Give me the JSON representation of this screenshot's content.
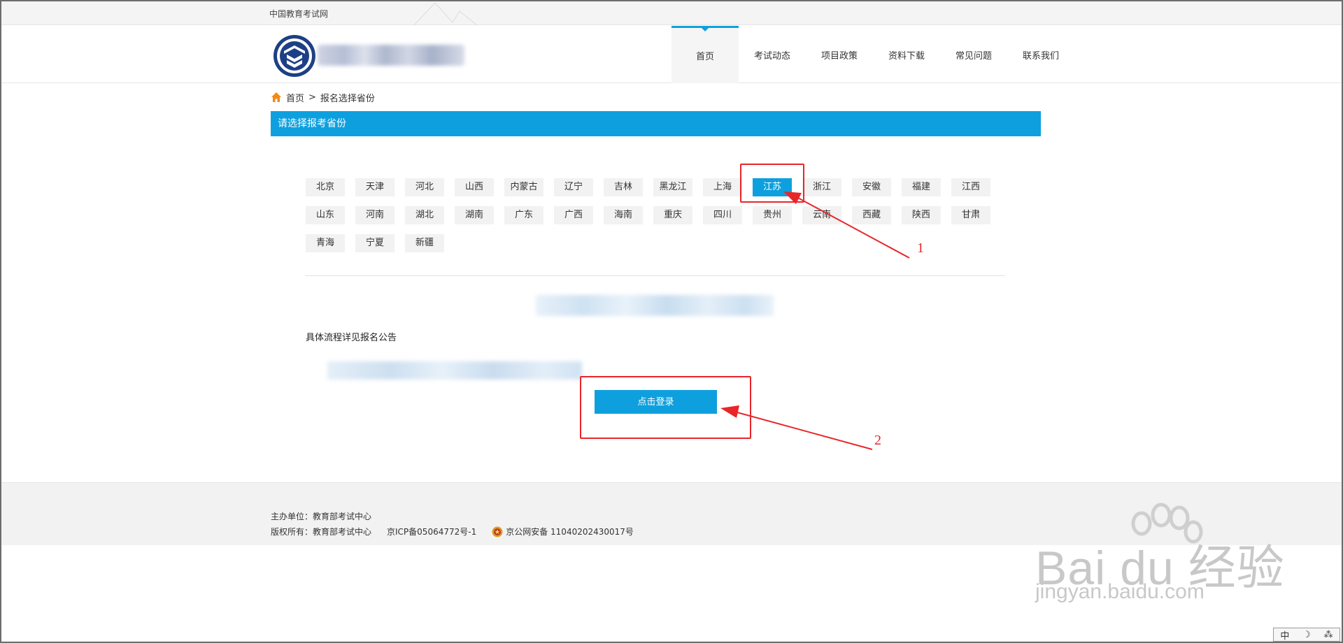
{
  "topbar": {
    "site_name": "中国教育考试网"
  },
  "nav": {
    "items": [
      "首页",
      "考试动态",
      "项目政策",
      "资料下载",
      "常见问题",
      "联系我们"
    ],
    "active_index": 0
  },
  "breadcrumb": {
    "home": "首页",
    "separator": ">",
    "current": "报名选择省份"
  },
  "panel": {
    "title": "请选择报考省份"
  },
  "provinces": {
    "row1": [
      "北京",
      "天津",
      "河北",
      "山西",
      "内蒙古",
      "辽宁",
      "吉林",
      "黑龙江",
      "上海",
      "江苏",
      "浙江",
      "安徽",
      "福建",
      "江西"
    ],
    "row2": [
      "山东",
      "河南",
      "湖北",
      "湖南",
      "广东",
      "广西",
      "海南",
      "重庆",
      "四川",
      "贵州",
      "云南",
      "西藏",
      "陕西",
      "甘肃"
    ],
    "row3": [
      "青海",
      "宁夏",
      "新疆"
    ],
    "selected": "江苏"
  },
  "content": {
    "process_note": "具体流程详见报名公告",
    "login_button": "点击登录"
  },
  "annotations": {
    "one": "1",
    "two": "2"
  },
  "footer": {
    "organizer": "主办单位：教育部考试中心",
    "copyright": "版权所有：教育部考试中心",
    "icp": "京ICP备05064772号-1",
    "police": "京公网安备 11040202430017号"
  },
  "watermark": {
    "brand": "Bai du 经验",
    "url": "jingyan.baidu.com"
  },
  "ime": {
    "items": [
      "中",
      "☽",
      "⁂"
    ]
  },
  "colors": {
    "accent": "#0ea0de",
    "annotation": "#e8262a",
    "footer_bg": "#f2f2f2"
  },
  "icons": {
    "home": "home-icon",
    "logo": "exam-center-logo",
    "police": "police-badge-icon"
  }
}
